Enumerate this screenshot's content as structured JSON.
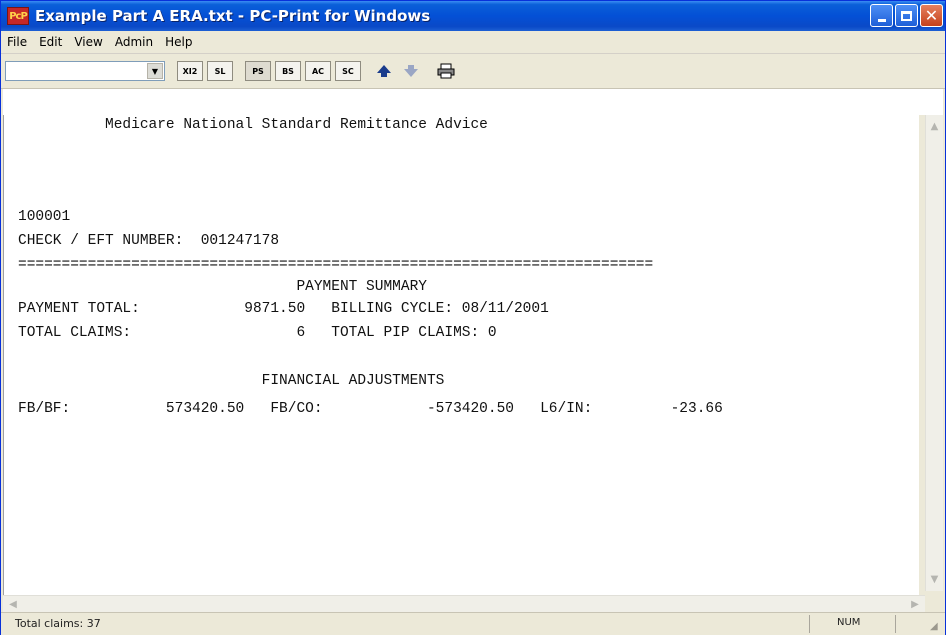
{
  "window": {
    "title": "Example Part A ERA.txt - PC-Print for Windows",
    "app_icon": "PcP"
  },
  "menu": [
    "File",
    "Edit",
    "View",
    "Admin",
    "Help"
  ],
  "toolbar": {
    "combo_value": "",
    "buttons": [
      "XI2",
      "SL",
      "PS",
      "BS",
      "AC",
      "SC"
    ],
    "icons": [
      "arrow-up-icon",
      "arrow-down-icon",
      "printer-icon"
    ]
  },
  "document": {
    "lines": [
      "          Medicare National Standard Remittance Advice",
      "",
      "",
      "",
      "100001",
      "CHECK / EFT NUMBER:  001247178",
      "=========================================================================",
      "                                PAYMENT SUMMARY",
      "PAYMENT TOTAL:            9871.50   BILLING CYCLE: 08/11/2001",
      "TOTAL CLAIMS:                   6   TOTAL PIP CLAIMS: 0",
      "",
      "                            FINANCIAL ADJUSTMENTS",
      "FB/BF:           573420.50   FB/CO:            -573420.50   L6/IN:         -23.66"
    ]
  },
  "status": {
    "left_text": "Total claims: 37",
    "num": "NUM"
  }
}
